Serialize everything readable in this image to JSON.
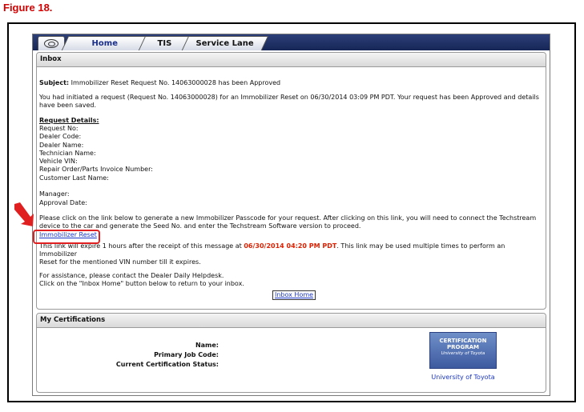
{
  "figure_caption": "Figure 18.",
  "tabs": [
    {
      "label": "Home"
    },
    {
      "label": "TIS"
    },
    {
      "label": "Service Lane"
    }
  ],
  "inbox": {
    "header": "Inbox",
    "subject_label": "Subject:",
    "subject_text": "Immobilizer Reset Request No. 14063000028 has been Approved",
    "intro_line1": "You had initiated a request (Request No. 14063000028) for an Immobilizer Reset on 06/30/2014 03:09 PM PDT. Your request has been Approved and details",
    "intro_line2": "have been saved.",
    "details_title": "Request Details:",
    "fields": [
      "Request No:",
      "Dealer Code:",
      "Dealer Name:",
      "Technician Name:",
      "Vehicle VIN:",
      "Repair Order/Parts Invoice Number:",
      "Customer Last Name:",
      "",
      "Manager:",
      "Approval Date:"
    ],
    "instruction_line1": "Please click on the link below to generate a new Immobilizer Passcode for your request. After clicking on this link, you will need to connect the Techstream",
    "instruction_line2": "device to the car and generate the Seed No. and enter the Techstream Software version to proceed.",
    "reset_link": "Immobilizer Reset",
    "expiry_part1": "This link will expire 1 hours after the receipt of this message at ",
    "expiry_time": "06/30/2014 04:20 PM PDT",
    "expiry_part2": ". This link may be used multiple times to perform an Immobilizer",
    "expiry_line2": "Reset for the mentioned VIN number till it expires.",
    "assist_line1": "For assistance, please contact the Dealer Daily Helpdesk.",
    "assist_line2": "Click on the \"Inbox Home\" button below to return to your inbox.",
    "inbox_home_button": "Inbox Home"
  },
  "certifications": {
    "header": "My Certifications",
    "name_label": "Name:",
    "job_code_label": "Primary Job Code:",
    "status_label": "Current Certification Status:",
    "badge_line1": "CERTIFICATION",
    "badge_line2": "PROGRAM",
    "badge_line3": "University of Toyota",
    "university_label": "University of Toyota"
  },
  "colors": {
    "caption_red": "#d40000",
    "tab_bar_navy": "#162656",
    "link_blue": "#1a36c8",
    "highlight_red": "#e02020"
  }
}
